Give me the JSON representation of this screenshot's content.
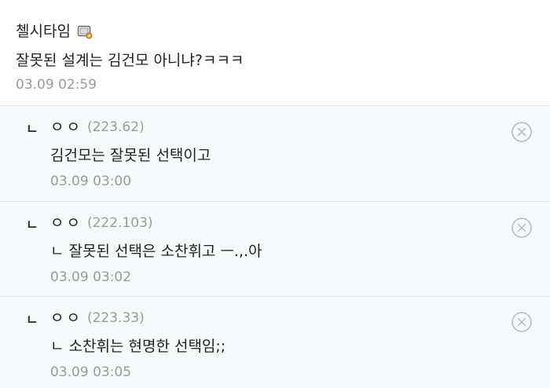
{
  "parent": {
    "author": "첼시타임",
    "body": "잘못된 설계는 김건모 아니냐?ㅋㅋㅋ",
    "time": "03.09 02:59",
    "member_icon": "member-badge-icon"
  },
  "replies": [
    {
      "arrow": "ㄴ",
      "author": "ㅇㅇ",
      "ip": "(223.62)",
      "body": "김건모는 잘못된 선택이고",
      "time": "03.09 03:00",
      "delete_icon": "close-icon"
    },
    {
      "arrow": "ㄴ",
      "author": "ㅇㅇ",
      "ip": "(222.103)",
      "body": "ㄴ 잘못된 선택은 소찬휘고 ㅡ.,.아",
      "time": "03.09 03:02",
      "delete_icon": "close-icon"
    },
    {
      "arrow": "ㄴ",
      "author": "ㅇㅇ",
      "ip": "(223.33)",
      "body": "ㄴ 소찬휘는 현명한 선택임;;",
      "time": "03.09 03:05",
      "delete_icon": "close-icon"
    }
  ],
  "colors": {
    "reply_background": "#f7f8fa",
    "divider": "#e3e5ea",
    "meta_text": "#9a9a9a",
    "primary_text": "#222222"
  }
}
